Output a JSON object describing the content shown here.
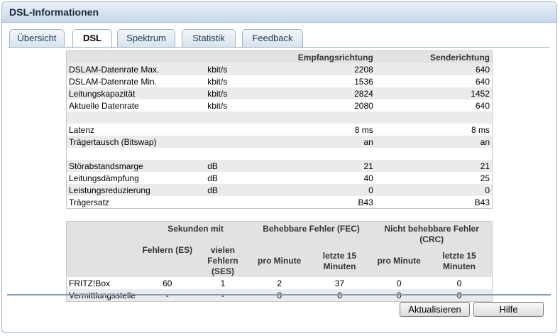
{
  "window": {
    "title": "DSL-Informationen"
  },
  "tabs": [
    {
      "label": "Übersicht",
      "active": false
    },
    {
      "label": "DSL",
      "active": true
    },
    {
      "label": "Spektrum",
      "active": false
    },
    {
      "label": "Statistik",
      "active": false
    },
    {
      "label": "Feedback",
      "active": false
    }
  ],
  "dsl_table": {
    "headers": {
      "rx": "Empfangsrichtung",
      "tx": "Senderichtung"
    },
    "rows": [
      {
        "label": "DSLAM-Datenrate Max.",
        "unit": "kbit/s",
        "rx": "2208",
        "tx": "640"
      },
      {
        "label": "DSLAM-Datenrate Min.",
        "unit": "kbit/s",
        "rx": "1536",
        "tx": "640"
      },
      {
        "label": "Leitungskapazität",
        "unit": "kbit/s",
        "rx": "2824",
        "tx": "1452"
      },
      {
        "label": "Aktuelle Datenrate",
        "unit": "kbit/s",
        "rx": "2080",
        "tx": "640"
      },
      {
        "label": "",
        "unit": "",
        "rx": "",
        "tx": ""
      },
      {
        "label": "Latenz",
        "unit": "",
        "rx": "8 ms",
        "tx": "8 ms"
      },
      {
        "label": "Trägertausch (Bitswap)",
        "unit": "",
        "rx": "an",
        "tx": "an"
      },
      {
        "label": "",
        "unit": "",
        "rx": "",
        "tx": ""
      },
      {
        "label": "Störabstandsmarge",
        "unit": "dB",
        "rx": "21",
        "tx": "21"
      },
      {
        "label": "Leitungsdämpfung",
        "unit": "dB",
        "rx": "40",
        "tx": "25"
      },
      {
        "label": "Leistungsreduzierung",
        "unit": "dB",
        "rx": "0",
        "tx": "0"
      },
      {
        "label": "Trägersatz",
        "unit": "",
        "rx": "B43",
        "tx": "B43"
      }
    ]
  },
  "error_table": {
    "group_headers": {
      "seconds": "Sekunden mit",
      "fec": "Behebbare Fehler (FEC)",
      "crc": "Nicht behebbare Fehler (CRC)"
    },
    "sub_headers": {
      "es": "Fehlern (ES)",
      "ses": "vielen Fehlern (SES)",
      "fec_min": "pro Minute",
      "fec_15": "letzte 15 Minuten",
      "crc_min": "pro Minute",
      "crc_15": "letzte 15 Minuten"
    },
    "rows": [
      {
        "label": "FRITZ!Box",
        "es": "60",
        "ses": "1",
        "fec_min": "2",
        "fec_15": "37",
        "crc_min": "0",
        "crc_15": "0"
      },
      {
        "label": "Vermittlungsstelle",
        "es": "-",
        "ses": "-",
        "fec_min": "0",
        "fec_15": "0",
        "crc_min": "0",
        "crc_15": "0"
      }
    ]
  },
  "buttons": {
    "refresh": "Aktualisieren",
    "help": "Hilfe"
  }
}
